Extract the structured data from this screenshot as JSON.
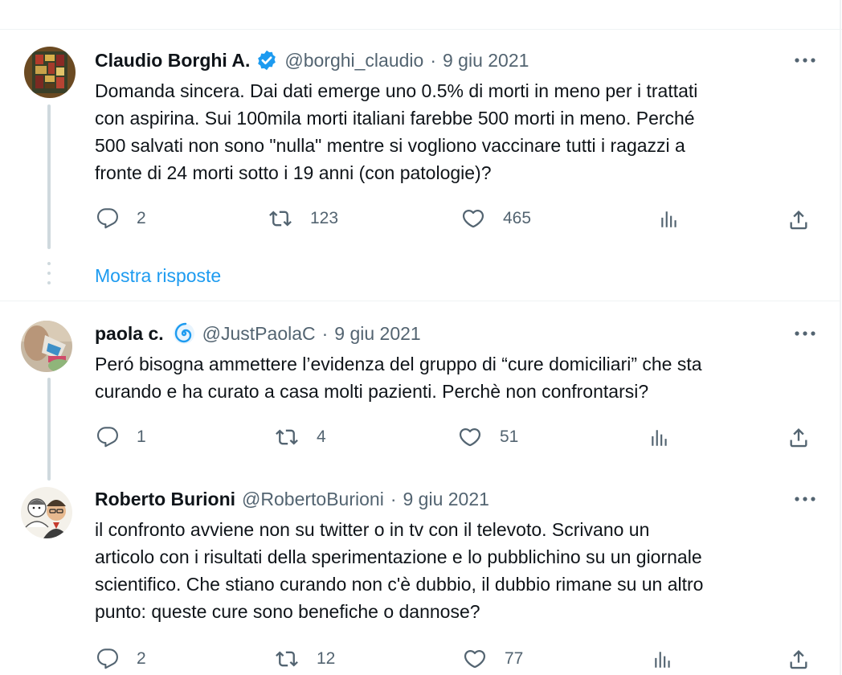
{
  "thread": {
    "show_replies_label": "Mostra risposte",
    "tweets": [
      {
        "name": "Claudio Borghi A.",
        "badge": "verified-badge-icon",
        "handle": "@borghi_claudio",
        "separator": "·",
        "date": "9 giu 2021",
        "text": "Domanda sincera. Dai dati emerge uno 0.5% di morti in meno per i trattati\ncon aspirina. Sui 100mila morti italiani farebbe 500 morti in meno. Perché\n500 salvati non sono \"nulla\" mentre si vogliono vaccinare tutti i ragazzi a\nfronte di 24 morti sotto i 19 anni (con patologie)?",
        "replies": "2",
        "retweets": "123",
        "likes": "465"
      },
      {
        "name": "paola c.",
        "badge": "spiral-emoji-icon",
        "handle": "@JustPaolaC",
        "separator": "·",
        "date": "9 giu 2021",
        "text": "Peró bisogna ammettere l’evidenza del gruppo di “cure domiciliari” che sta\ncurando e ha curato a casa molti pazienti. Perchè non confrontarsi?",
        "replies": "1",
        "retweets": "4",
        "likes": "51"
      },
      {
        "name": "Roberto Burioni",
        "handle": "@RobertoBurioni",
        "separator": "·",
        "date": "9 giu 2021",
        "text": "il confronto avviene non su twitter o in tv con il televoto. Scrivano  un\narticolo con i risultati della sperimentazione e lo pubblichino su un giornale\nscientifico. Che stiano curando non c'è dubbio, il dubbio rimane su un altro\npunto: queste cure sono benefiche o dannose?",
        "replies": "2",
        "retweets": "12",
        "likes": "77"
      }
    ]
  },
  "colors": {
    "text": "#0f1419",
    "secondary": "#536471",
    "accent": "#1d9bf0",
    "divider": "#eff3f4",
    "thread_line": "#cfd9de"
  }
}
